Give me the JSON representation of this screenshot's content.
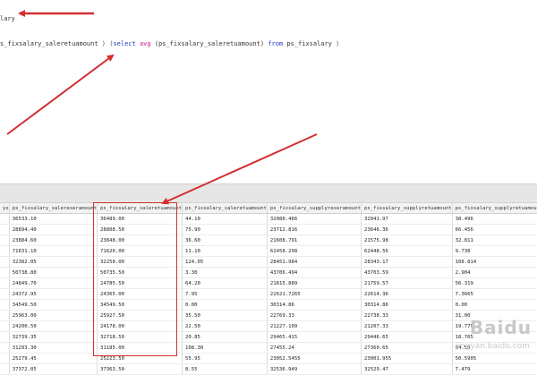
{
  "editor": {
    "line1": "lary",
    "line2_col": "s_fixsalary_saleretuamount",
    "line2_rest_open": " ) (",
    "kw_select": "select",
    "fn_avg": "avg",
    "arg": "(ps_fixsalary_saleretuamount)",
    "kw_from": "from",
    "table_name": "ps_fixsalary",
    "line2_close": ")"
  },
  "grid": {
    "columns": [
      "ys",
      "ps_fixsalary_salereseramount",
      "ps_fixsalary_saleretuamount",
      "ps_fixsalary_saleretuamount",
      "ps_fixsalary_supplyreseramount",
      "ps_fixsalary_supplyretuamount",
      "ps_fixsalary_supplyretuamount",
      "ps_fixsalary_supplyretuamount",
      "ps_f"
    ],
    "rows": [
      [
        "",
        "36533.10",
        "36489.00",
        "44.10",
        "32080.466",
        "32041.97",
        "38.496",
        "0.00"
      ],
      [
        "",
        "28894.40",
        "28808.50",
        "75.90",
        "23712.816",
        "23646.36",
        "66.456",
        "30.42"
      ],
      [
        "",
        "23884.60",
        "23848.00",
        "36.60",
        "21608.791",
        "21575.98",
        "32.811",
        "0.00"
      ],
      [
        "",
        "71631.10",
        "71620.00",
        "11.10",
        "62458.298",
        "62448.56",
        "9.738",
        "0.00"
      ],
      [
        "",
        "32382.05",
        "32258.00",
        "124.05",
        "28451.984",
        "28343.17",
        "108.814",
        "0.00"
      ],
      [
        "",
        "50738.80",
        "50735.50",
        "3.30",
        "43706.494",
        "43703.59",
        "2.904",
        "0.00"
      ],
      [
        "",
        "24849.70",
        "24785.50",
        "64.20",
        "21815.889",
        "21759.57",
        "56.319",
        "0.00"
      ],
      [
        "",
        "24372.95",
        "24365.00",
        "7.95",
        "22621.7265",
        "22614.36",
        "7.3665",
        "0.00"
      ],
      [
        "",
        "34549.50",
        "34549.50",
        "0.00",
        "30314.86",
        "30314.86",
        "0.00",
        "0.00"
      ],
      [
        "",
        "25963.00",
        "25927.50",
        "35.50",
        "22769.33",
        "22738.33",
        "31.00",
        "0.00"
      ],
      [
        "",
        "24200.50",
        "24178.00",
        "22.50",
        "21227.109",
        "21207.33",
        "19.779",
        "0.00"
      ],
      [
        "",
        "32739.35",
        "32718.50",
        "20.85",
        "29465.415",
        "29446.65",
        "18.765",
        "0.00"
      ],
      [
        "",
        "31293.30",
        "31185.00",
        "108.30",
        "27455.24",
        "27360.65",
        "94.59",
        "0.00"
      ],
      [
        "",
        "25279.45",
        "25223.50",
        "55.95",
        "23052.5455",
        "23001.955",
        "50.5905",
        "128.9"
      ],
      [
        "",
        "37372.05",
        "37363.50",
        "8.55",
        "32536.949",
        "32529.47",
        "7.479",
        "0.00"
      ]
    ]
  },
  "watermark": {
    "main": "Baidu",
    "sub": "jingyan.baidu.com"
  },
  "colors": {
    "annotation_red": "#d32f2f",
    "keyword_blue": "#1f3ac7",
    "function_pink": "#c7168f"
  }
}
